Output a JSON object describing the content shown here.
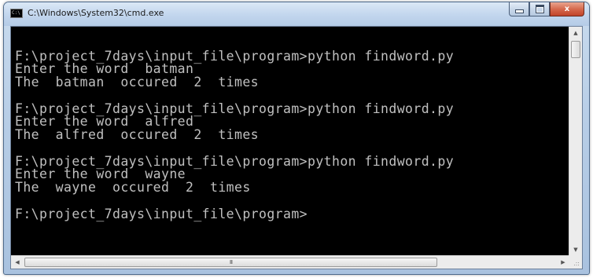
{
  "window": {
    "title": "C:\\Windows\\System32\\cmd.exe",
    "icon": "cmd-icon",
    "icon_text": "C:\\",
    "buttons": {
      "minimize": "minimize-icon",
      "maximize": "maximize-icon",
      "close_glyph": "x"
    }
  },
  "console": {
    "background": "#000000",
    "foreground": "#c0c0c0",
    "lines": [
      "F:\\project_7days\\input_file\\program>python findword.py",
      "Enter the word  batman",
      "The  batman  occured  2  times",
      "F:\\project_7days\\input_file\\program>python findword.py",
      "Enter the word  alfred",
      "The  alfred  occured  2  times",
      "F:\\project_7days\\input_file\\program>python findword.py",
      "Enter the word  wayne",
      "The  wayne  occured  2  times",
      "F:\\project_7days\\input_file\\program>"
    ]
  },
  "scrollbars": {
    "up_arrow": "▲",
    "down_arrow": "▼",
    "left_arrow": "◀",
    "right_arrow": "▶",
    "h_thumb_grip": "III",
    "size_grip": ".::"
  }
}
